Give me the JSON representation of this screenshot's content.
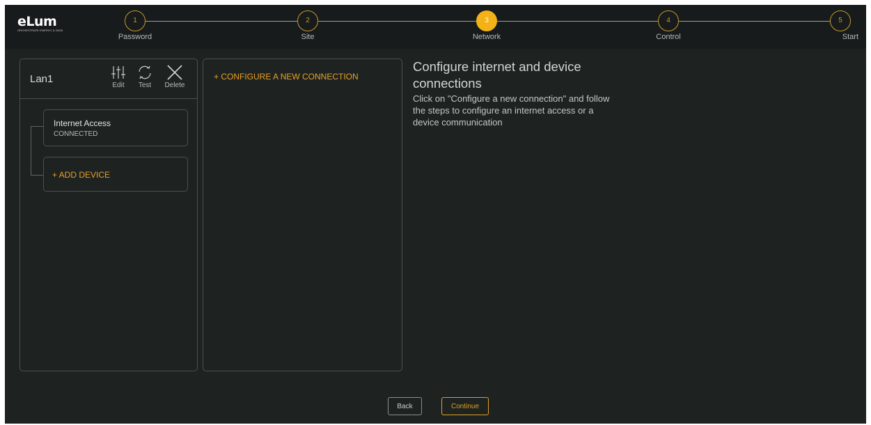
{
  "brand": {
    "name": "eLum",
    "tagline": "ORCHESTRATE ENERGY & DATA"
  },
  "stepper": {
    "steps": [
      {
        "number": "1",
        "label": "Password"
      },
      {
        "number": "2",
        "label": "Site"
      },
      {
        "number": "3",
        "label": "Network",
        "active": true
      },
      {
        "number": "4",
        "label": "Control"
      },
      {
        "number": "5",
        "label": "Start"
      }
    ],
    "accent_color": "#f2b218"
  },
  "lan_panel": {
    "title": "Lan1",
    "toolbar": {
      "edit_label": "Edit",
      "test_label": "Test",
      "delete_label": "Delete"
    },
    "internet_card": {
      "title": "Internet Access",
      "status": "CONNECTED"
    },
    "add_device_label": "+ ADD DEVICE"
  },
  "connections_panel": {
    "configure_label": "+ CONFIGURE A NEW CONNECTION"
  },
  "info": {
    "title": "Configure internet and device connections",
    "body": "Click on \"Configure a new connection\" and follow the steps to configure an internet access or a device communication"
  },
  "footer": {
    "back_label": "Back",
    "continue_label": "Continue"
  },
  "colors": {
    "background": "#1e2322",
    "header": "#171b1b",
    "accent": "#e8a023"
  }
}
